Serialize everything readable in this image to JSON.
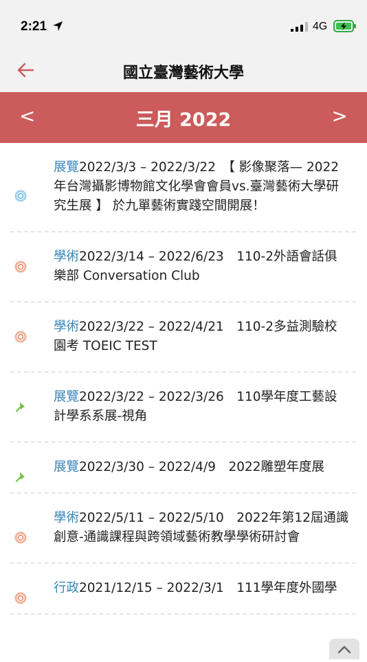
{
  "status": {
    "time": "2:21",
    "network": "4G"
  },
  "nav": {
    "title": "國立臺灣藝術大學"
  },
  "month": {
    "label": "三月 2022",
    "prev": "<",
    "next": ">"
  },
  "events": [
    {
      "category": "展覽",
      "text": "2022/3/3 – 2022/3/22　【 影像聚落— 2022年台灣攝影博物館文化學會會員vs.臺灣藝術大學研究生展 】 於九單藝術實踐空間開展！",
      "icon": "ring-blue-icon"
    },
    {
      "category": "學術",
      "text": "2022/3/14 – 2022/6/23　110-2外語會話俱樂部 Conversation Club",
      "icon": "ring-orange-icon"
    },
    {
      "category": "學術",
      "text": "2022/3/22 – 2022/4/21　110-2多益測驗校園考 TOEIC TEST",
      "icon": "ring-orange-icon"
    },
    {
      "category": "展覽",
      "text": "2022/3/22 – 2022/3/26　110學年度工藝設計學系系展-視角",
      "icon": "pin-icon"
    },
    {
      "category": "展覽",
      "text": "2022/3/30 – 2022/4/9　2022雕塑年度展",
      "icon": "pin-icon"
    },
    {
      "category": "學術",
      "text": "2022/5/11 – 2022/5/10　2022年第12屆通識創意-通識課程與跨領域藝術教學學術研討會",
      "icon": "ring-orange-icon"
    },
    {
      "category": "行政",
      "text": "2021/12/15 – 2022/3/1　111學年度外國學",
      "icon": "ring-orange-icon"
    }
  ],
  "colors": {
    "header": "#cc5b5b",
    "category": "#3a86b8",
    "back": "#cc5b5b"
  }
}
